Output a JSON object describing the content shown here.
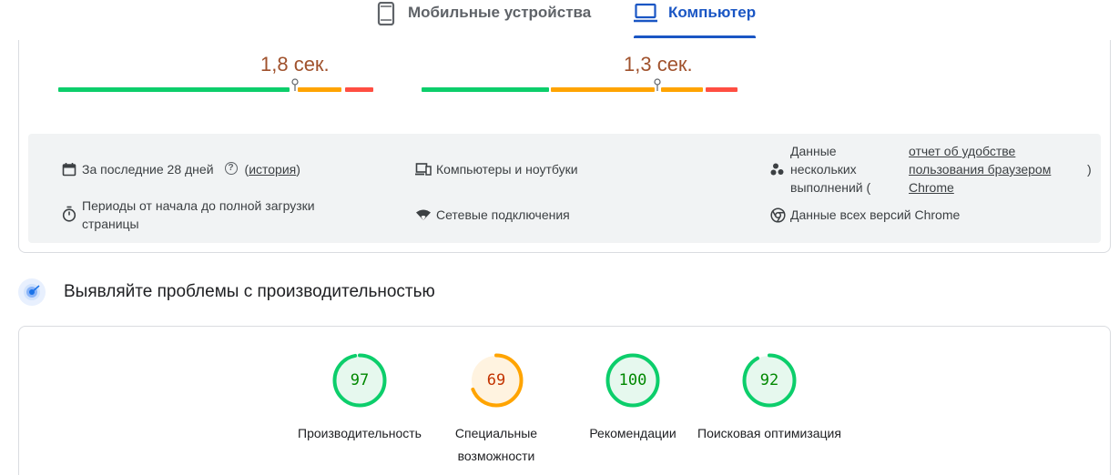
{
  "tabs": {
    "mobile": {
      "label": "Мобильные устройства",
      "icon": "smartphone-icon"
    },
    "desktop": {
      "label": "Компьютер",
      "icon": "laptop-icon",
      "active": true
    }
  },
  "metrics": [
    {
      "value": "1,8 сек.",
      "marker_fraction": 0.75
    },
    {
      "value": "1,3 сек.",
      "marker_fraction": 0.75
    }
  ],
  "info": {
    "period": "За последние 28 дней",
    "history_open": "(",
    "history_link": "история",
    "history_close": ")",
    "devices": "Компьютеры и ноутбуки",
    "multi_runs": "Данные нескольких выполнений (",
    "report_link": "отчет об удобстве пользования браузером Chrome",
    "report_close": ")",
    "load_periods": "Периоды от начала до полной загрузки страницы",
    "network": "Сетевые подключения",
    "chrome_versions": "Данные всех версий Chrome"
  },
  "section": {
    "title": "Выявляйте проблемы с производительностью"
  },
  "scores": [
    {
      "score": "97",
      "fraction": 0.97,
      "label": "Производительность",
      "status": "good"
    },
    {
      "score": "69",
      "fraction": 0.69,
      "label": "Специальные возможности",
      "status": "average"
    },
    {
      "score": "100",
      "fraction": 1.0,
      "label": "Рекомендации",
      "status": "good"
    },
    {
      "score": "92",
      "fraction": 0.92,
      "label": "Поисковая оптимизация",
      "status": "good"
    }
  ],
  "colors": {
    "accent": "#1a56c4",
    "good": "#0cce6b",
    "average": "#ffa400",
    "poor": "#ff4e42",
    "good_text": "#008800",
    "average_text": "#c33300",
    "good_bg": "#e6f8ee",
    "average_bg": "#fff3e0"
  }
}
